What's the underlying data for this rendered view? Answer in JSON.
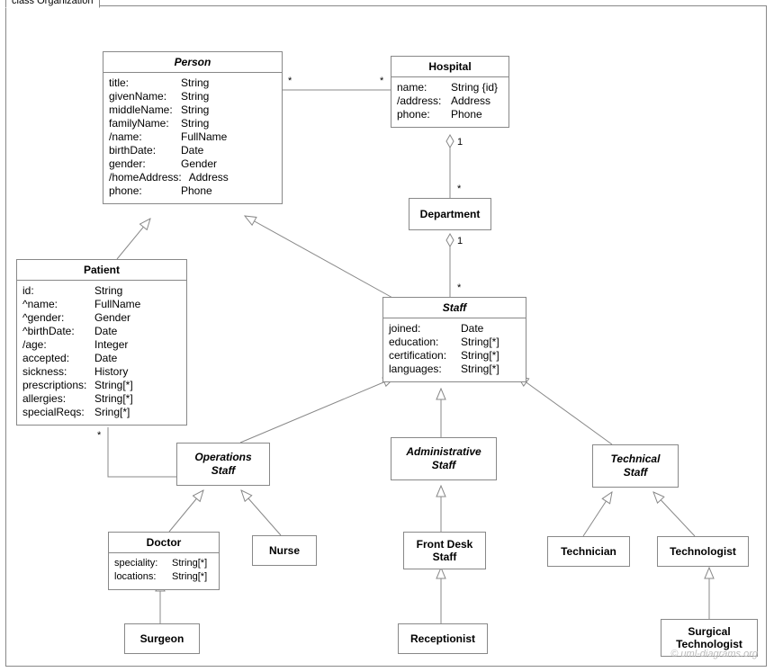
{
  "frame": {
    "title": "class Organization"
  },
  "classes": {
    "person": {
      "name": "Person",
      "attrs": [
        {
          "name": "title:",
          "type": "String"
        },
        {
          "name": "givenName:",
          "type": "String"
        },
        {
          "name": "middleName:",
          "type": "String"
        },
        {
          "name": "familyName:",
          "type": "String"
        },
        {
          "name": "/name:",
          "type": "FullName"
        },
        {
          "name": "birthDate:",
          "type": "Date"
        },
        {
          "name": "gender:",
          "type": "Gender"
        },
        {
          "name": "/homeAddress:",
          "type": "Address"
        },
        {
          "name": "phone:",
          "type": "Phone"
        }
      ]
    },
    "hospital": {
      "name": "Hospital",
      "attrs": [
        {
          "name": "name:",
          "type": "String {id}"
        },
        {
          "name": "/address:",
          "type": "Address"
        },
        {
          "name": "phone:",
          "type": "Phone"
        }
      ]
    },
    "department": {
      "name": "Department"
    },
    "patient": {
      "name": "Patient",
      "attrs": [
        {
          "name": "id:",
          "type": "String"
        },
        {
          "name": "^name:",
          "type": "FullName"
        },
        {
          "name": "^gender:",
          "type": "Gender"
        },
        {
          "name": "^birthDate:",
          "type": "Date"
        },
        {
          "name": "/age:",
          "type": "Integer"
        },
        {
          "name": "accepted:",
          "type": "Date"
        },
        {
          "name": "sickness:",
          "type": "History"
        },
        {
          "name": "prescriptions:",
          "type": "String[*]"
        },
        {
          "name": "allergies:",
          "type": "String[*]"
        },
        {
          "name": "specialReqs:",
          "type": "Sring[*]"
        }
      ]
    },
    "staff": {
      "name": "Staff",
      "attrs": [
        {
          "name": "joined:",
          "type": "Date"
        },
        {
          "name": "education:",
          "type": "String[*]"
        },
        {
          "name": "certification:",
          "type": "String[*]"
        },
        {
          "name": "languages:",
          "type": "String[*]"
        }
      ]
    },
    "opsStaff": {
      "name": "Operations",
      "name2": "Staff"
    },
    "adminStaff": {
      "name": "Administrative",
      "name2": "Staff"
    },
    "techStaff": {
      "name": "Technical",
      "name2": "Staff"
    },
    "doctor": {
      "name": "Doctor",
      "attrs": [
        {
          "name": "speciality:",
          "type": "String[*]"
        },
        {
          "name": "locations:",
          "type": "String[*]"
        }
      ]
    },
    "nurse": {
      "name": "Nurse"
    },
    "frontDesk": {
      "name": "Front Desk",
      "name2": "Staff"
    },
    "receptionist": {
      "name": "Receptionist"
    },
    "surgeon": {
      "name": "Surgeon"
    },
    "technician": {
      "name": "Technician"
    },
    "technologist": {
      "name": "Technologist"
    },
    "surgTech": {
      "name": "Surgical",
      "name2": "Technologist"
    }
  },
  "mult": {
    "person_hospital_left": "*",
    "person_hospital_right": "*",
    "hospital_dept_one": "1",
    "hospital_dept_many": "*",
    "dept_staff_one": "1",
    "dept_staff_many": "*",
    "patient_ops_left": "*",
    "patient_ops_right": "*"
  },
  "watermark": "© uml-diagrams.org"
}
